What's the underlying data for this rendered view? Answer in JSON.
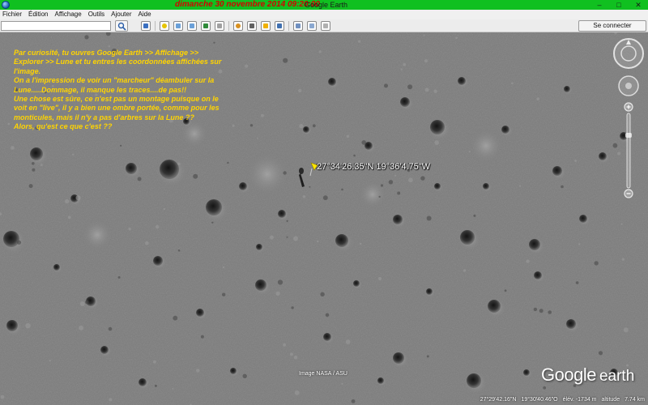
{
  "window": {
    "date_title": "dimanche 30 novembre 2014  09:20:00",
    "app_title": "Google Earth",
    "controls": [
      "–",
      "□",
      "✕"
    ]
  },
  "menu": [
    "Fichier",
    "Édition",
    "Affichage",
    "Outils",
    "Ajouter",
    "Aide"
  ],
  "toolbar": {
    "search_value": "",
    "signin_label": "Se connecter"
  },
  "overlay": {
    "paragraphs": [
      "Par curiosité, tu ouvres Google Earth >> Affichage >> Explorer >> Lune et tu entres les coordonnées affichées sur l'image.",
      "On a l'impression de voir un \"marcheur\" déambuler sur la Lune.....Dommage, il manque les traces....de pas!!",
      "Une chose est sûre, ce n'est pas un montage puisque on le voit en \"live\", il y a bien une ombre portée, comme pour les monticules, mais il n'y a pas d'arbres sur la Lune ??",
      "Alors, qu'est ce que c'est ??"
    ]
  },
  "placemark": {
    "label": "27°34'26.35\"N 19°36'4.75\"W",
    "color": "#ffe600"
  },
  "map": {
    "credit": "Image NASA / ASU",
    "logo_word1": "Google",
    "logo_word2": "earth"
  },
  "status": {
    "lat": "27°29'42.16\"N",
    "lon": "19°30'40.46\"O",
    "elevation": "élév. -1734 m",
    "altitude_label": "altitude",
    "altitude_value": "7.74 km"
  },
  "colors": {
    "titlebar": "#10c020",
    "date_text": "#d40000",
    "overlay_text": "#ffd400",
    "moon_surface": "#7c7c7c"
  }
}
